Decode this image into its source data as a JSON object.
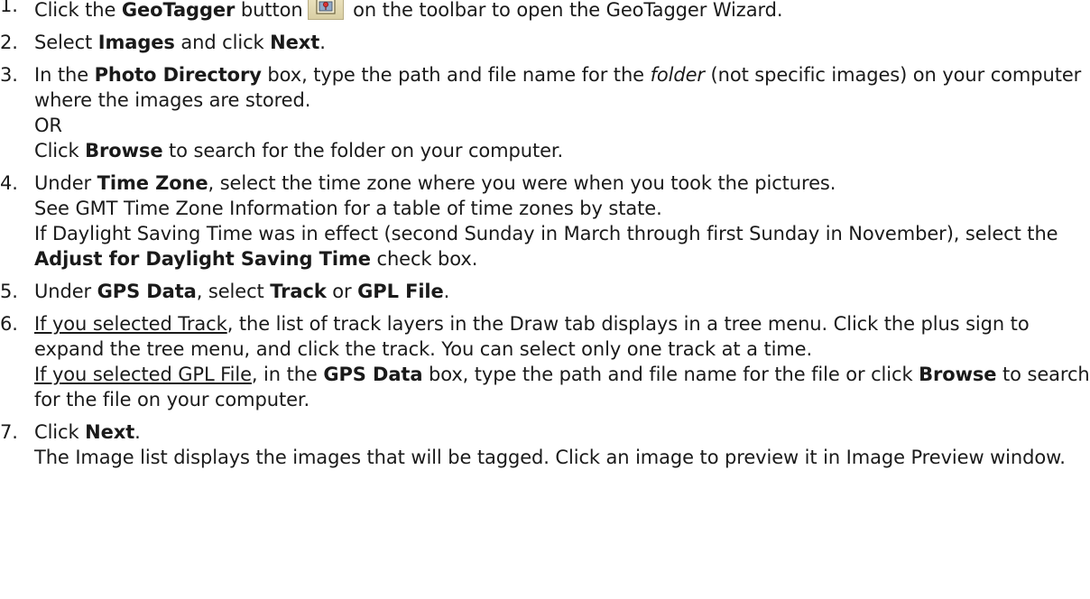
{
  "steps": [
    {
      "num": "1.",
      "t1": "Click the ",
      "b1": "GeoTagger",
      "t2": " button",
      "icon": "geotagger-toolbar-icon",
      "t3": " on the toolbar to open the GeoTagger Wizard."
    },
    {
      "num": "2.",
      "t1": "Select ",
      "b1": "Images",
      "t2": " and click ",
      "b2": "Next",
      "t3": "."
    },
    {
      "num": "3.",
      "t1": "In the ",
      "b1": "Photo Directory",
      "t2": " box, type the path and file name for the ",
      "i1": "folder",
      "t3": " (not specific images) on your computer where the images are stored.",
      "or": "OR",
      "t4": "Click ",
      "b2": "Browse",
      "t5": " to search for the folder on your computer."
    },
    {
      "num": "4.",
      "t1": "Under ",
      "b1": "Time Zone",
      "t2": ", select the time zone where you were when you took the pictures.",
      "line2": "See GMT Time Zone Information for a table of time zones by state.",
      "t3": "If Daylight Saving Time was in effect (second Sunday in March through first Sunday in November), select the ",
      "b2": "Adjust for Daylight Saving Time",
      "t4": " check box."
    },
    {
      "num": "5.",
      "t1": "Under ",
      "b1": "GPS Data",
      "t2": ", select ",
      "b2": "Track",
      "t3": " or ",
      "b3": "GPL File",
      "t4": "."
    },
    {
      "num": "6.",
      "u1": "If you selected Track",
      "t1": ", the list of track layers in the Draw tab displays in a tree menu. Click the plus sign to expand the tree menu, and click the track. You can select only one track at a time.",
      "u2": "If you selected GPL File",
      "t2": ", in the ",
      "b1": "GPS Data",
      "t3": " box, type the path and file name for the file or click ",
      "b2": "Browse",
      "t4": " to search for the file on your computer."
    },
    {
      "num": "7.",
      "t1": "Click ",
      "b1": "Next",
      "t2": ".",
      "line2": "The Image list displays the images that will be tagged. Click an image to preview it in Image Preview window."
    }
  ]
}
